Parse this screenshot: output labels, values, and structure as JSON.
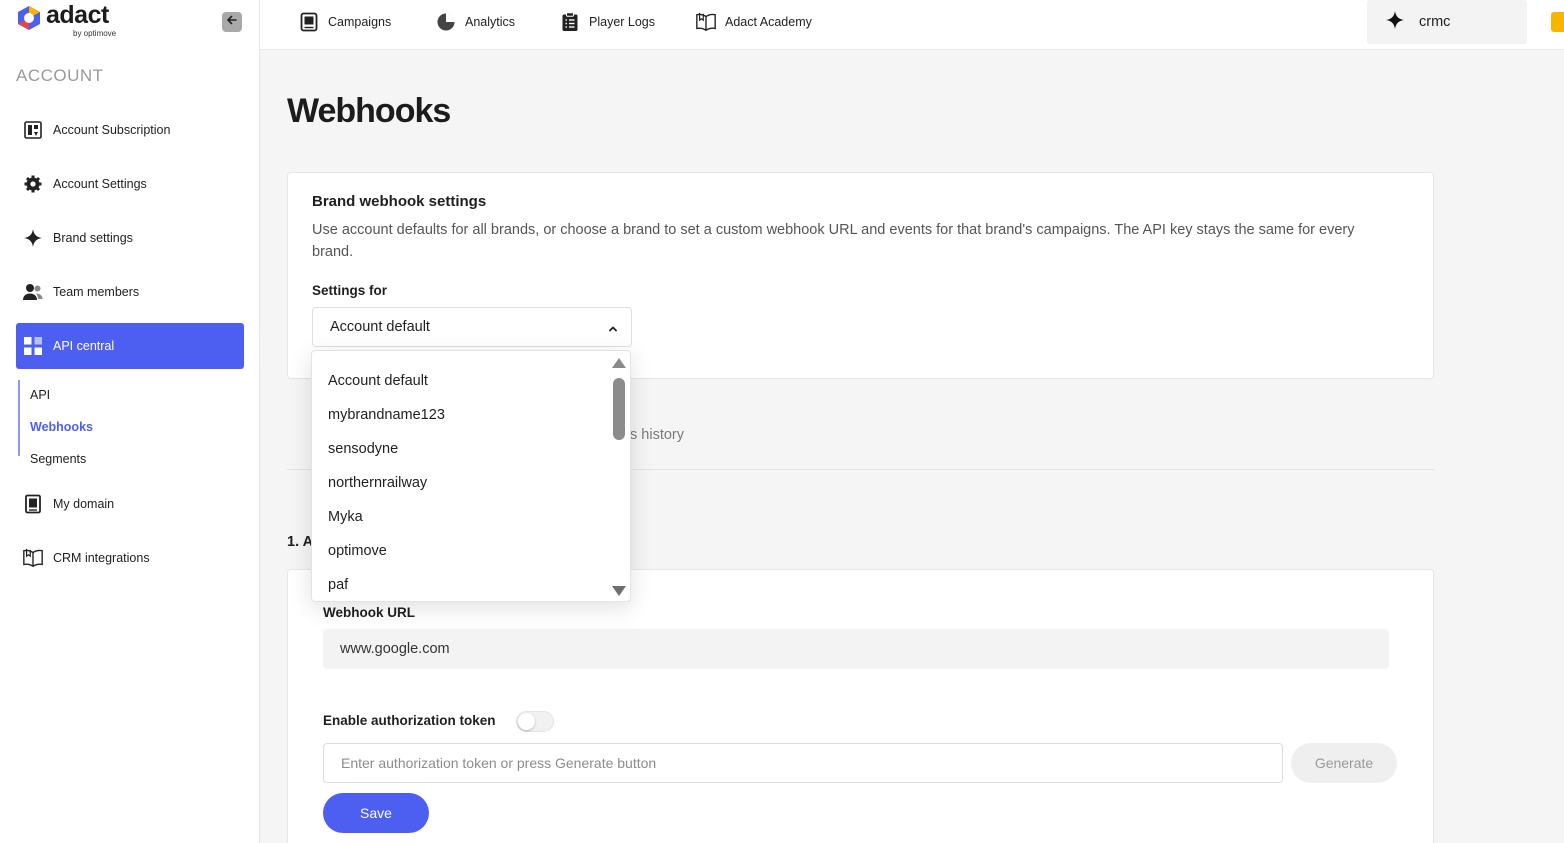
{
  "logo": {
    "name": "adact",
    "sub": "by optimove"
  },
  "sidebar": {
    "section_title": "ACCOUNT",
    "items": [
      {
        "label": "Account Subscription",
        "icon": "subscription-icon"
      },
      {
        "label": "Account Settings",
        "icon": "gear-icon"
      },
      {
        "label": "Brand settings",
        "icon": "sparkle-icon"
      },
      {
        "label": "Team members",
        "icon": "users-icon"
      },
      {
        "label": "API central",
        "icon": "grid-icon",
        "active": true
      },
      {
        "label": "My domain",
        "icon": "domain-icon"
      },
      {
        "label": "CRM integrations",
        "icon": "book-icon"
      }
    ],
    "sub_items": [
      {
        "label": "API"
      },
      {
        "label": "Webhooks",
        "active": true
      },
      {
        "label": "Segments"
      }
    ]
  },
  "topbar": {
    "links": [
      {
        "label": "Campaigns",
        "icon": "campaigns-icon"
      },
      {
        "label": "Analytics",
        "icon": "pie-chart-icon"
      },
      {
        "label": "Player Logs",
        "icon": "clipboard-icon"
      },
      {
        "label": "Adact Academy",
        "icon": "book-icon"
      }
    ],
    "brand": "crmc"
  },
  "main": {
    "title": "Webhooks",
    "brand_card": {
      "title": "Brand webhook settings",
      "description": "Use account defaults for all brands, or choose a brand to set a custom webhook URL and events for that brand's campaigns. The API key stays the same for every brand.",
      "settings_label": "Settings for",
      "selected": "Account default"
    },
    "tab_fragment": "s history",
    "step_label": "1. A",
    "webhook_url_label": "Webhook URL",
    "webhook_url_value": "www.google.com",
    "auth_token_label": "Enable authorization token",
    "auth_token_enabled": false,
    "token_placeholder": "Enter authorization token or press Generate button",
    "generate_label": "Generate",
    "save_label": "Save"
  },
  "dropdown": {
    "options": [
      "Account default",
      "mybrandname123",
      "sensodyne",
      "northernrailway",
      "Myka",
      "optimove",
      "paf"
    ]
  },
  "colors": {
    "accent": "#4d5ff1",
    "brand_yellow": "#f7b500"
  }
}
